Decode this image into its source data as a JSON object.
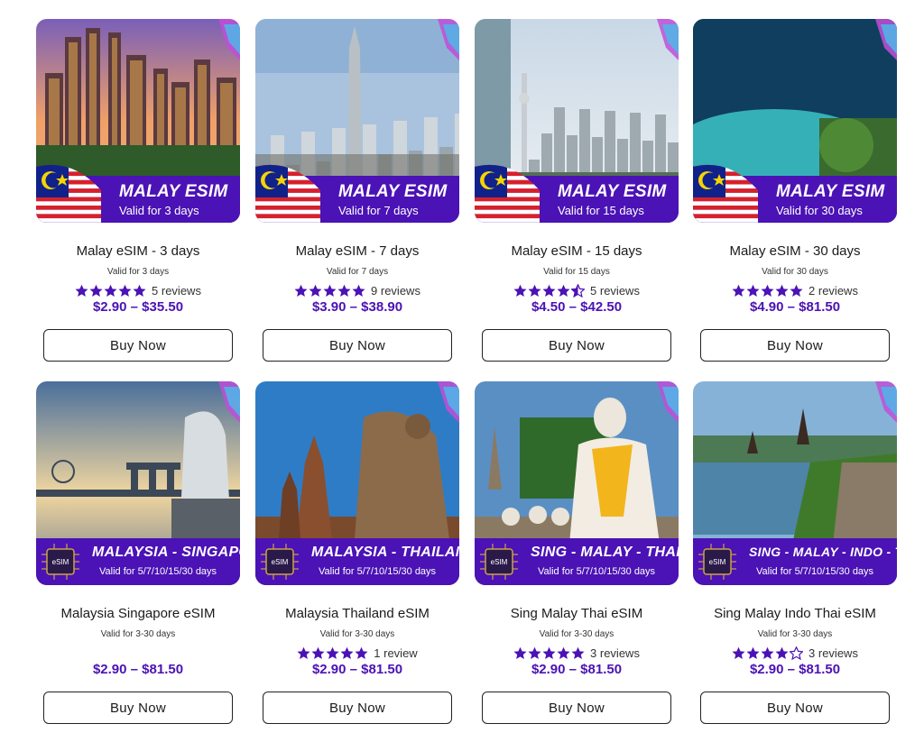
{
  "colors": {
    "accent": "#4b12b5",
    "star": "#4b12b5"
  },
  "products": [
    {
      "banner_title": "MALAY ESIM",
      "banner_subtitle": "Valid for 3 days",
      "banner_style": "flag",
      "name": "Malay eSIM - 3 days",
      "validity": "Valid for 3 days",
      "rating": 5,
      "reviews": "5 reviews",
      "price": "$2.90 – $35.50",
      "button": "Buy Now",
      "scene": "city-sunset"
    },
    {
      "banner_title": "MALAY ESIM",
      "banner_subtitle": "Valid for 7 days",
      "banner_style": "flag",
      "name": "Malay eSIM - 7 days",
      "validity": "Valid for 7 days",
      "rating": 5,
      "reviews": "9 reviews",
      "price": "$3.90 – $38.90",
      "button": "Buy Now",
      "scene": "city-tower"
    },
    {
      "banner_title": "MALAY ESIM",
      "banner_subtitle": "Valid for 15 days",
      "banner_style": "flag",
      "name": "Malay eSIM - 15 days",
      "validity": "Valid for 15 days",
      "rating": 4.5,
      "reviews": "5 reviews",
      "price": "$4.50 – $42.50",
      "button": "Buy Now",
      "scene": "city-day"
    },
    {
      "banner_title": "MALAY ESIM",
      "banner_subtitle": "Valid for 30 days",
      "banner_style": "flag",
      "name": "Malay eSIM - 30 days",
      "validity": "Valid for 30 days",
      "rating": 5,
      "reviews": "2 reviews",
      "price": "$4.90 – $81.50",
      "button": "Buy Now",
      "scene": "island"
    },
    {
      "banner_title": "MALAYSIA - SINGAPORE",
      "banner_subtitle": "Valid for 5/7/10/15/30 days",
      "banner_style": "chip",
      "name": "Malaysia Singapore eSIM",
      "validity": "Valid for 3-30 days",
      "rating": 0,
      "reviews": "",
      "price": "$2.90 – $81.50",
      "button": "Buy Now",
      "scene": "merlion"
    },
    {
      "banner_title": "MALAYSIA - THAILAND",
      "banner_subtitle": "Valid for 5/7/10/15/30 days",
      "banner_style": "chip",
      "name": "Malaysia Thailand eSIM",
      "validity": "Valid for 3-30 days",
      "rating": 5,
      "reviews": "1 review",
      "price": "$2.90 – $81.50",
      "button": "Buy Now",
      "scene": "temple"
    },
    {
      "banner_title": "SING - MALAY - THAI",
      "banner_subtitle": "Valid for 5/7/10/15/30 days",
      "banner_style": "chip",
      "name": "Sing Malay Thai eSIM",
      "validity": "Valid for 3-30 days",
      "rating": 5,
      "reviews": "3 reviews",
      "price": "$2.90 – $81.50",
      "button": "Buy Now",
      "scene": "buddha"
    },
    {
      "banner_title": "SING - MALAY - INDO - THAI",
      "banner_subtitle": "Valid for 5/7/10/15/30 days",
      "banner_style": "chip",
      "name": "Sing Malay Indo Thai eSIM",
      "validity": "Valid for 3-30 days",
      "rating": 4,
      "reviews": "3 reviews",
      "price": "$2.90 – $81.50",
      "button": "Buy Now",
      "scene": "lake-temple"
    }
  ]
}
